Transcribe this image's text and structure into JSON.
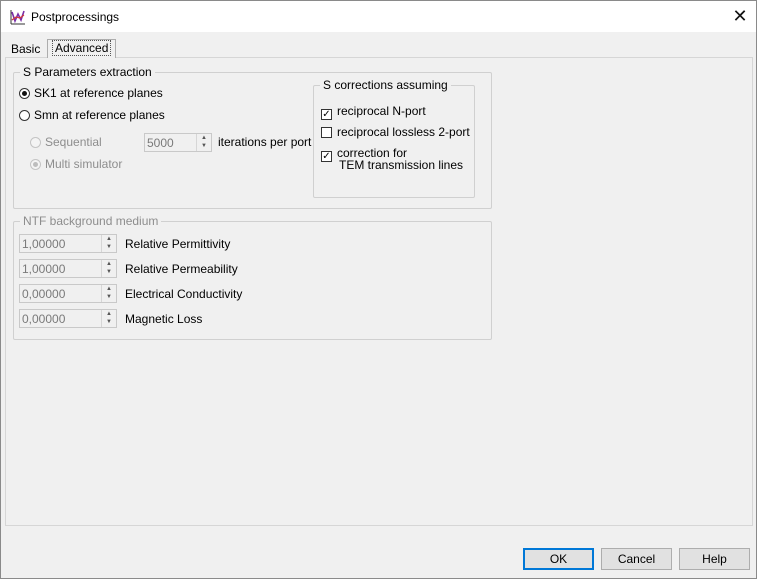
{
  "window": {
    "title": "Postprocessings",
    "icon": "chart-app-icon",
    "close_glyph": "✕"
  },
  "tabs": [
    {
      "label": "Basic",
      "selected": false
    },
    {
      "label": "Advanced",
      "selected": true
    }
  ],
  "s_params": {
    "legend": "S Parameters extraction",
    "options": [
      {
        "label": "SK1 at reference planes",
        "checked": true
      },
      {
        "label": "Smn at reference planes",
        "checked": false
      }
    ],
    "sub_options": [
      {
        "label": "Sequential",
        "checked": false,
        "enabled": false
      },
      {
        "label": "Multi simulator",
        "checked": true,
        "enabled": false
      }
    ],
    "iterations": {
      "value": "5000",
      "suffix": "iterations per port",
      "enabled": false
    }
  },
  "s_corrections": {
    "legend": "S corrections assuming",
    "items": [
      {
        "label": "reciprocal N-port",
        "checked": true
      },
      {
        "label": "reciprocal lossless 2-port",
        "checked": false
      },
      {
        "label_line1": "correction for",
        "label_line2": "TEM transmission lines",
        "checked": true
      }
    ]
  },
  "ntf": {
    "legend": "NTF background medium",
    "enabled": false,
    "fields": [
      {
        "value": "1,00000",
        "label": "Relative Permittivity"
      },
      {
        "value": "1,00000",
        "label": "Relative Permeability"
      },
      {
        "value": "0,00000",
        "label": "Electrical Conductivity"
      },
      {
        "value": "0,00000",
        "label": "Magnetic Loss"
      }
    ]
  },
  "buttons": {
    "ok": "OK",
    "cancel": "Cancel",
    "help": "Help"
  },
  "glyphs": {
    "check": "✓",
    "spin_up": "▲",
    "spin_down": "▼"
  },
  "colors": {
    "accent": "#0078d7",
    "disabled_text": "#8d8d8d"
  }
}
